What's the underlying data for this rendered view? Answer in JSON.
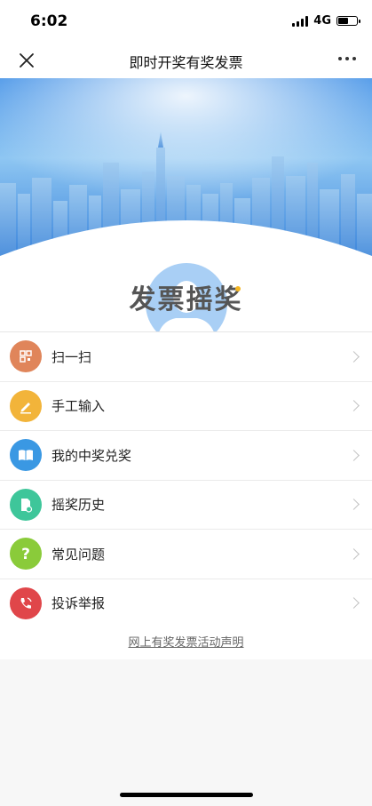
{
  "status": {
    "time": "6:02",
    "network": "4G"
  },
  "nav": {
    "title": "即时开奖有奖发票"
  },
  "hero": {
    "brand_title": "发票摇奖"
  },
  "menu": {
    "items": [
      {
        "label": "扫一扫",
        "icon": "qr-scan-icon",
        "color": "#e0855a"
      },
      {
        "label": "手工输入",
        "icon": "pencil-icon",
        "color": "#f2b43a"
      },
      {
        "label": "我的中奖兑奖",
        "icon": "book-icon",
        "color": "#3a98e3"
      },
      {
        "label": "摇奖历史",
        "icon": "document-icon",
        "color": "#3ec69a"
      },
      {
        "label": "常见问题",
        "icon": "question-icon",
        "color": "#8acb3a"
      },
      {
        "label": "投诉举报",
        "icon": "phone-icon",
        "color": "#e0464a"
      }
    ]
  },
  "footer": {
    "link": "网上有奖发票活动声明"
  }
}
